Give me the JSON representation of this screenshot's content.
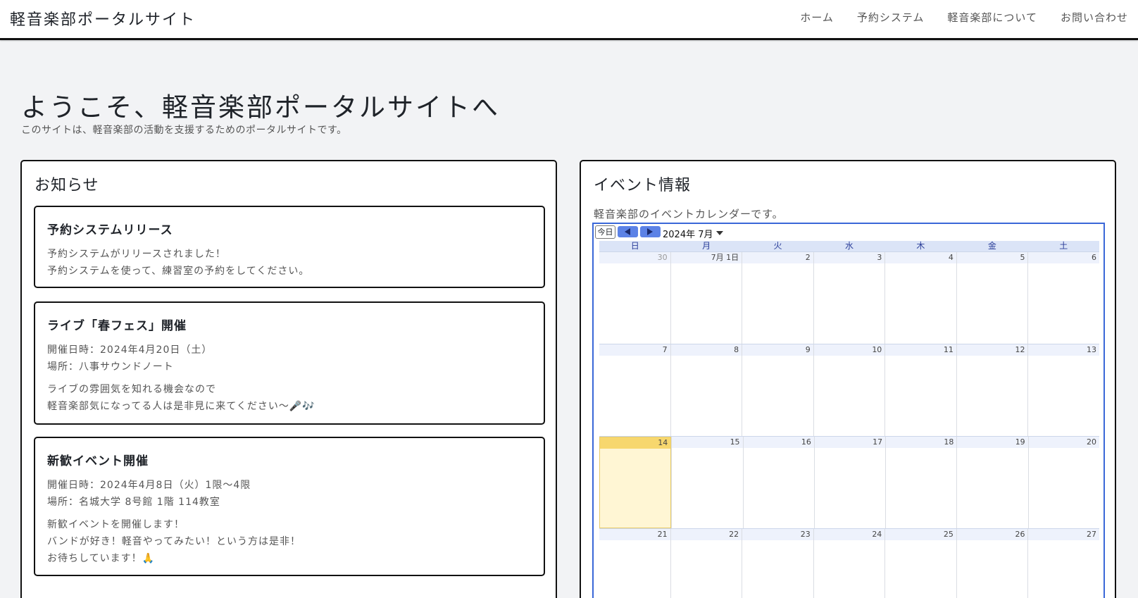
{
  "navbar": {
    "brand": "軽音楽部ポータルサイト",
    "links": [
      "ホーム",
      "予約システム",
      "軽音楽部について",
      "お問い合わせ"
    ]
  },
  "hero": {
    "title": "ようこそ、軽音楽部ポータルサイトへ",
    "subtitle": "このサイトは、軽音楽部の活動を支援するためのポータルサイトです。"
  },
  "news": {
    "heading": "お知らせ",
    "items": [
      {
        "title": "予約システムリリース",
        "paragraphs": [
          [
            "予約システムがリリースされました！",
            "予約システムを使って、練習室の予約をしてください。"
          ]
        ]
      },
      {
        "title": "ライブ「春フェス」開催",
        "paragraphs": [
          [
            "開催日時：2024年4月20日（土）",
            "場所：八事サウンドノート"
          ],
          [
            "ライブの雰囲気を知れる機会なので",
            "軽音楽部気になってる人は是非見に来てください〜🎤🎶"
          ]
        ]
      },
      {
        "title": "新歓イベント開催",
        "paragraphs": [
          [
            "開催日時：2024年4月8日（火）1限〜4限",
            "場所：名城大学 8号館 1階 114教室"
          ],
          [
            "新歓イベントを開催します！",
            "バンドが好き！軽音やってみたい！という方は是非！",
            "お待ちしています！🙏"
          ]
        ]
      }
    ]
  },
  "events": {
    "heading": "イベント情報",
    "description": "軽音楽部のイベントカレンダーです。",
    "calendar": {
      "today_label": "今日",
      "month_label": "2024年 7月",
      "weekdays": [
        "日",
        "月",
        "火",
        "水",
        "木",
        "金",
        "土"
      ],
      "weeks": [
        [
          "30",
          "7月 1日",
          "2",
          "3",
          "4",
          "5",
          "6"
        ],
        [
          "7",
          "8",
          "9",
          "10",
          "11",
          "12",
          "13"
        ],
        [
          "14",
          "15",
          "16",
          "17",
          "18",
          "19",
          "20"
        ],
        [
          "21",
          "22",
          "23",
          "24",
          "25",
          "26",
          "27"
        ]
      ],
      "today": "14",
      "colors": {
        "border": "#3a67d8",
        "nav_button": "#5c82e6",
        "today_bg": "#fff6d4",
        "today_header": "#f7d76e",
        "weekday_bar": "#dbe4f7"
      }
    }
  }
}
